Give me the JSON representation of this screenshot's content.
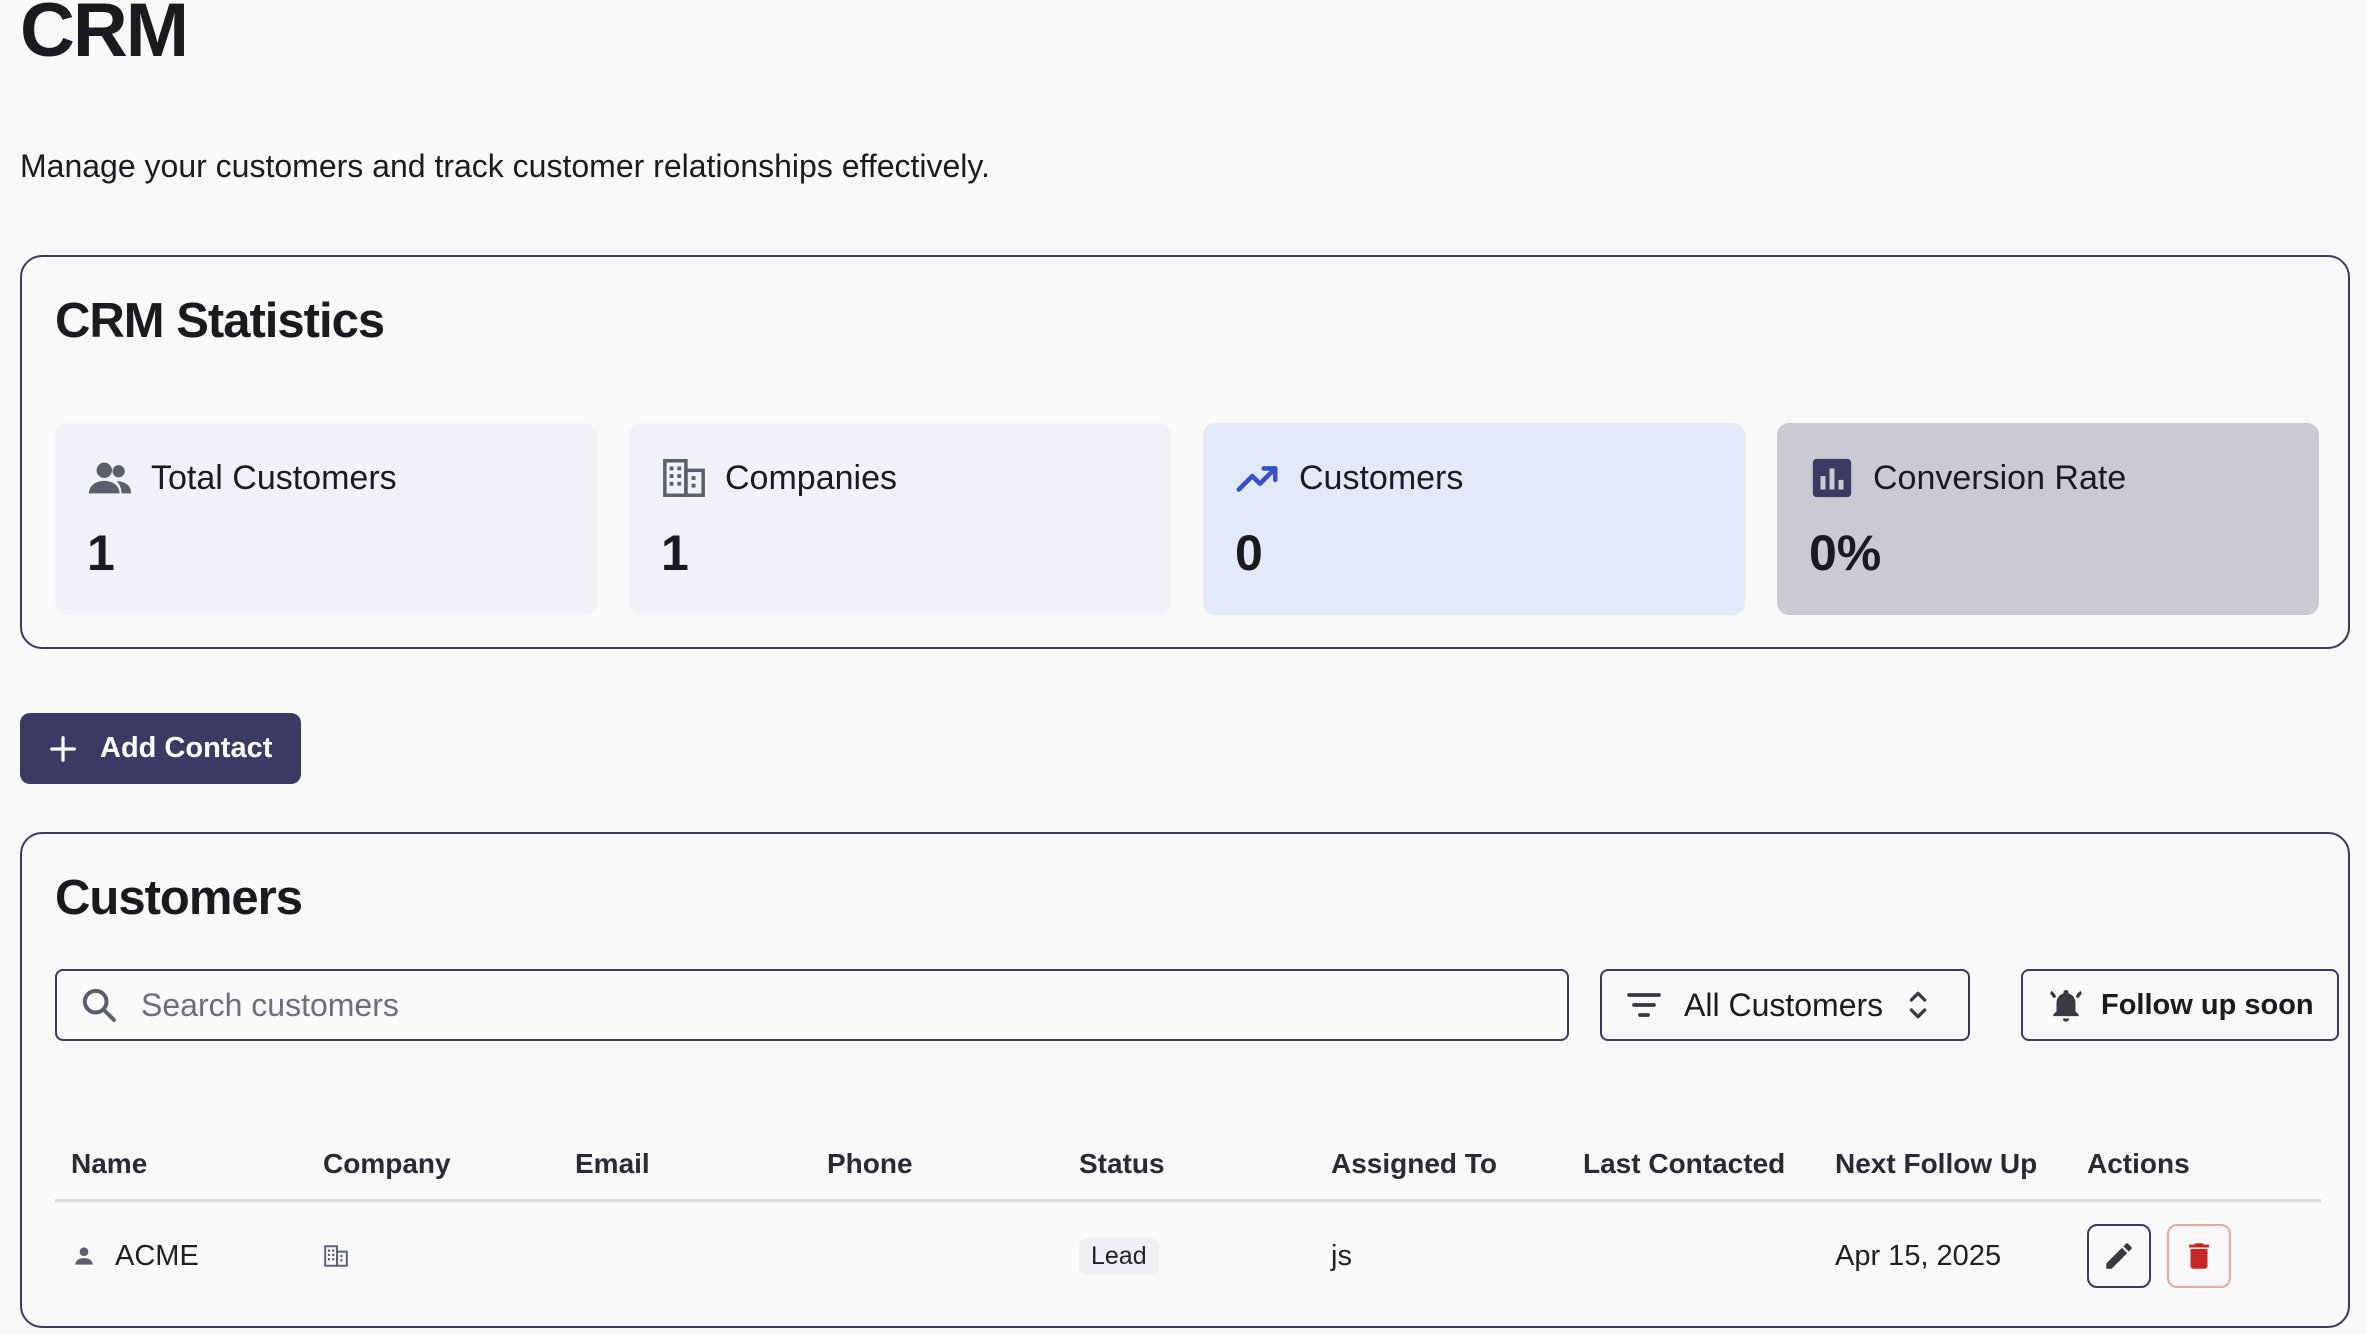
{
  "header": {
    "title": "CRM",
    "subtitle": "Manage your customers and track customer relationships effectively."
  },
  "stats": {
    "title": "CRM Statistics",
    "cards": [
      {
        "label": "Total Customers",
        "value": "1",
        "icon": "users-icon"
      },
      {
        "label": "Companies",
        "value": "1",
        "icon": "building-icon"
      },
      {
        "label": "Customers",
        "value": "0",
        "icon": "trending-up-icon"
      },
      {
        "label": "Conversion Rate",
        "value": "0%",
        "icon": "bar-chart-icon"
      }
    ]
  },
  "actions": {
    "add_contact_label": "Add Contact"
  },
  "customers": {
    "title": "Customers",
    "search_placeholder": "Search customers",
    "filter_value": "All Customers",
    "follow_up_label": "Follow up soon",
    "columns": [
      "Name",
      "Company",
      "Email",
      "Phone",
      "Status",
      "Assigned To",
      "Last Contacted",
      "Next Follow Up",
      "Actions"
    ],
    "rows": [
      {
        "name": "ACME",
        "company": "",
        "email": "",
        "phone": "",
        "status": "Lead",
        "assigned_to": "js",
        "last_contacted": "",
        "next_follow_up": "Apr 15, 2025"
      }
    ]
  },
  "colors": {
    "primary": "#3a3a63",
    "card_default": "#f0f2f7",
    "card_blue": "#e3e8fa",
    "card_gray": "#cacad3",
    "trend_icon": "#3553c9",
    "delete": "#c62828"
  }
}
